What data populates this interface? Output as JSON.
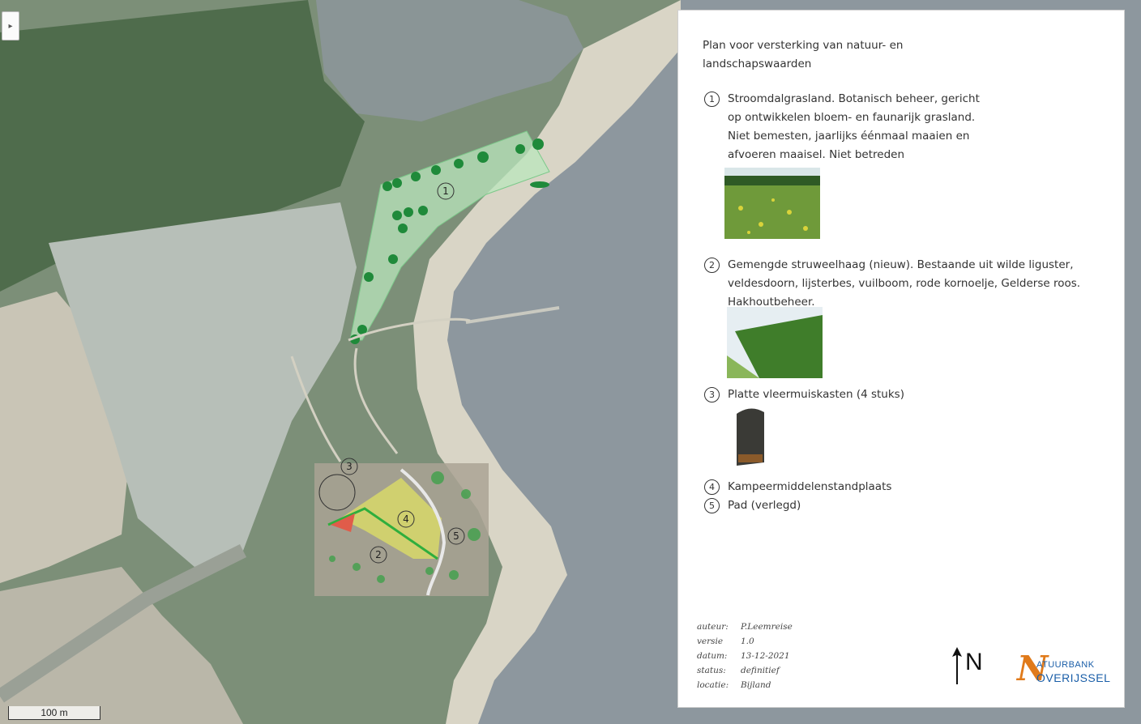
{
  "colors": {
    "water": "#8d979e",
    "floodplain_green": "#6f8f6a",
    "beach": "#d9d5c6",
    "plan_area": "#b9e6bc",
    "tree": "#1f8a3a",
    "campsite": "#b7bfb8",
    "hedge": "#2fae3d",
    "camping_zone": "#d8d86a",
    "logo_orange": "#e07a1a",
    "logo_blue": "#1a5ea8"
  },
  "map": {
    "labels": {
      "zone_1": "1",
      "zone_2": "2",
      "zone_3": "3",
      "zone_4": "4",
      "zone_5": "5"
    },
    "scale_label": "100 m",
    "side_toggle_icon": "chevron-right-icon"
  },
  "legend": {
    "title": "Plan voor versterking van natuur- en\nlandschapswaarden",
    "items": [
      {
        "number": "1",
        "text": "Stroomdalgrasland. Botanisch beheer, gericht\nop ontwikkelen bloem- en faunarijk grasland.\nNiet bemesten, jaarlijks éénmaal maaien en\nafvoeren maaisel. Niet betreden",
        "photo_icon": "meadow-photo"
      },
      {
        "number": "2",
        "text": "Gemengde struweelhaag (nieuw). Bestaande uit wilde liguster,\nveldesdoorn, lijsterbes, vuilboom, rode kornoelje,  Gelderse roos.\n Hakhoutbeheer.",
        "photo_icon": "hedge-photo"
      },
      {
        "number": "3",
        "text": "Platte vleermuiskasten (4 stuks)",
        "photo_icon": "bat-box-photo"
      },
      {
        "number": "4",
        "text": "Kampeermiddelenstandplaats"
      },
      {
        "number": "5",
        "text": "Pad (verlegd)"
      }
    ]
  },
  "metadata": [
    {
      "label": "auteur:",
      "value": "P.Leemreise"
    },
    {
      "label": "versie",
      "value": "1.0"
    },
    {
      "label": "datum:",
      "value": "13-12-2021"
    },
    {
      "label": "status:",
      "value": "definitief"
    },
    {
      "label": "locatie:",
      "value": "Bijland"
    }
  ],
  "north_arrow": {
    "label": "N",
    "icon": "north-arrow-icon"
  },
  "logo": {
    "mark": "N",
    "line1": "ATUURBANK",
    "line2": "OVERIJSSEL"
  }
}
